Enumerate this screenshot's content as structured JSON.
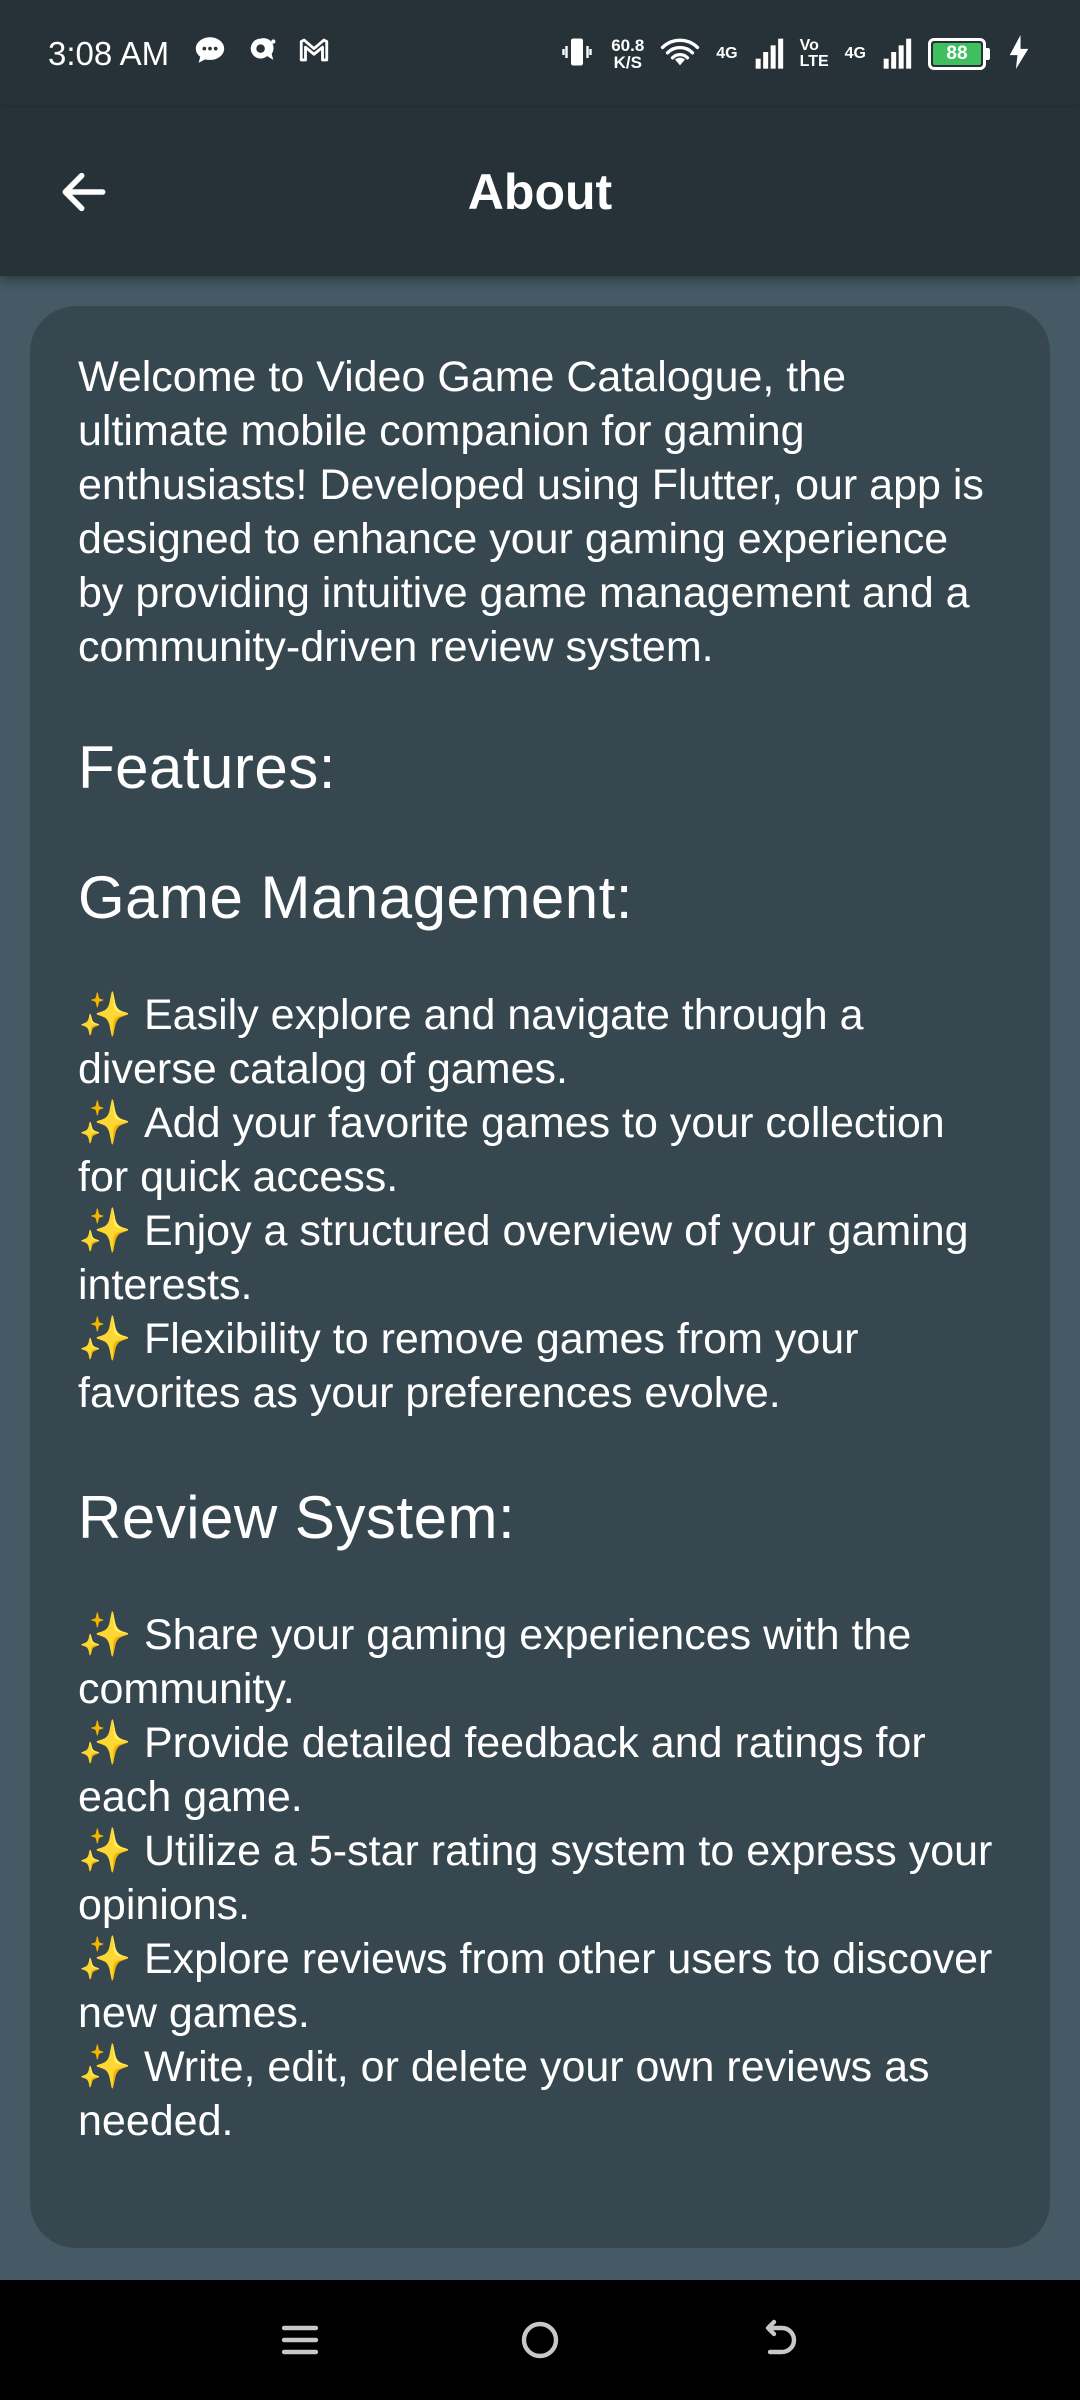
{
  "status_bar": {
    "time": "3:08 AM",
    "speed_value": "60.8",
    "speed_unit": "K/S",
    "network1": "4G",
    "volte_top": "Vo",
    "volte_bottom": "LTE",
    "network2": "4G",
    "battery": "88",
    "icons": [
      "chat-bubble-icon",
      "notification-bubble-icon",
      "gmail-icon",
      "vibrate-icon",
      "wifi-icon",
      "signal-icon",
      "charging-icon"
    ]
  },
  "app_bar": {
    "title": "About",
    "back_icon": "arrow-left-icon"
  },
  "content": {
    "intro": "Welcome to Video Game Catalogue, the ultimate mobile companion for gaming enthusiasts! Developed using Flutter, our app is designed to enhance your gaming experience by providing intuitive game management and a community-driven review system.",
    "features_heading": "Features:",
    "game_management": {
      "heading": "Game Management:",
      "bullet_prefix": "✨",
      "items": [
        "Easily explore and navigate through a diverse catalog of games.",
        "Add your favorite games to your collection for quick access.",
        "Enjoy a structured overview of your gaming interests.",
        "Flexibility to remove games from your favorites as your preferences evolve."
      ]
    },
    "review_system": {
      "heading": "Review System:",
      "bullet_prefix": "✨",
      "items": [
        "Share your gaming experiences with the community.",
        "Provide detailed feedback and ratings for each game.",
        "Utilize a 5-star rating system to express your opinions.",
        "Explore reviews from other users to discover new games.",
        "Write, edit, or delete your own reviews as needed."
      ]
    }
  },
  "nav_bar": {
    "icons": [
      "menu-icon",
      "home-icon",
      "back-icon"
    ]
  },
  "colors": {
    "background": "#455a64",
    "bar": "#263238",
    "card": "#37474f",
    "battery": "#3fbf60"
  }
}
